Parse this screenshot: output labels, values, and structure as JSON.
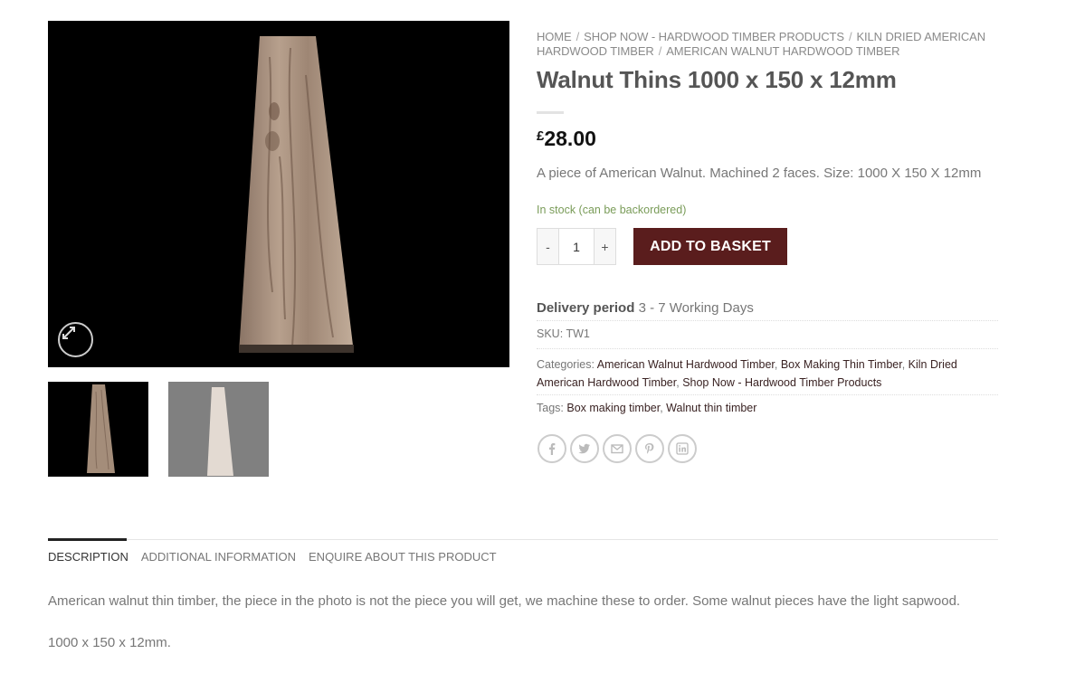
{
  "breadcrumb": {
    "items": [
      "HOME",
      "SHOP NOW - HARDWOOD TIMBER PRODUCTS",
      "KILN DRIED AMERICAN HARDWOOD TIMBER",
      "AMERICAN WALNUT HARDWOOD TIMBER"
    ],
    "separator": "/"
  },
  "product": {
    "title": "Walnut Thins 1000 x 150 x 12mm",
    "currency": "£",
    "price": "28.00",
    "short_description": "A piece of American Walnut. Machined 2 faces. Size: 1000 X 150 X 12mm",
    "stock": "In stock (can be backordered)",
    "quantity": "1",
    "minus": "-",
    "plus": "+",
    "add_to_basket": "ADD TO BASKET"
  },
  "meta": {
    "delivery_label": "Delivery period",
    "delivery_value": "3 - 7 Working Days",
    "sku_label": "SKU:",
    "sku_value": "TW1",
    "categories_label": "Categories:",
    "categories": [
      "American Walnut Hardwood Timber",
      "Box Making Thin Timber",
      "Kiln Dried American Hardwood Timber",
      "Shop Now - Hardwood Timber Products"
    ],
    "tags_label": "Tags:",
    "tags": [
      "Box making timber",
      "Walnut thin timber"
    ]
  },
  "share_icons": [
    "facebook-icon",
    "twitter-icon",
    "email-icon",
    "pinterest-icon",
    "linkedin-icon"
  ],
  "tabs": [
    "DESCRIPTION",
    "ADDITIONAL INFORMATION",
    "ENQUIRE ABOUT THIS PRODUCT"
  ],
  "description": {
    "p1": "American walnut thin timber, the piece in the photo is not the piece you will get, we machine these to order. Some walnut pieces have the light sapwood.",
    "p2": "1000 x 150 x 12mm."
  },
  "colors": {
    "accent": "#5a1d1d",
    "stock": "#7a9c59",
    "link": "#3a2323"
  }
}
